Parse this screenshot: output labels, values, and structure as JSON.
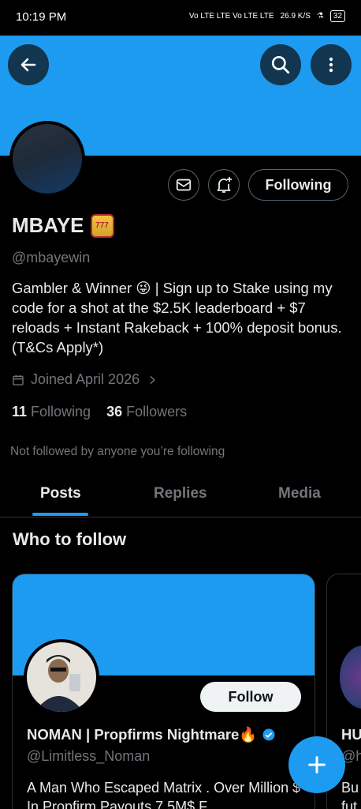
{
  "status_bar": {
    "time": "10:19 PM",
    "network": "Vo LTE  LTE  Vo LTE  LTE",
    "speed": "26.9 K/S",
    "battery": "32"
  },
  "profile": {
    "name": "MBAYE",
    "handle": "@mbayewin",
    "bio": "Gambler & Winner 😜 | Sign up to Stake using my code for a shot at the $2.5K leaderboard + $7 reloads + Instant Rakeback + 100% deposit bonus. (T&Cs Apply*)",
    "joined": "Joined April 2026",
    "following_count": "11",
    "following_label": "Following",
    "followers_count": "36",
    "followers_label": "Followers",
    "not_followed": "Not followed by anyone you’re following",
    "following_button": "Following"
  },
  "tabs": [
    {
      "label": "Posts",
      "active": true
    },
    {
      "label": "Replies",
      "active": false
    },
    {
      "label": "Media",
      "active": false
    }
  ],
  "who_to_follow": {
    "title": "Who to follow",
    "cards": [
      {
        "name": "NOMAN | Propfirms Nightmare🔥",
        "handle": "@Limitless_Noman",
        "bio": "A Man Who Escaped Matrix . Over Million $ In Propfirm Payouts 7.5M$ F...",
        "follow_label": "Follow",
        "verified": true
      },
      {
        "name": "HU",
        "handle": "@h",
        "bio": "Bu fut"
      }
    ]
  },
  "colors": {
    "accent": "#1d9bf0",
    "background": "#000000",
    "text": "#e7e9ea",
    "muted": "#71767b"
  }
}
